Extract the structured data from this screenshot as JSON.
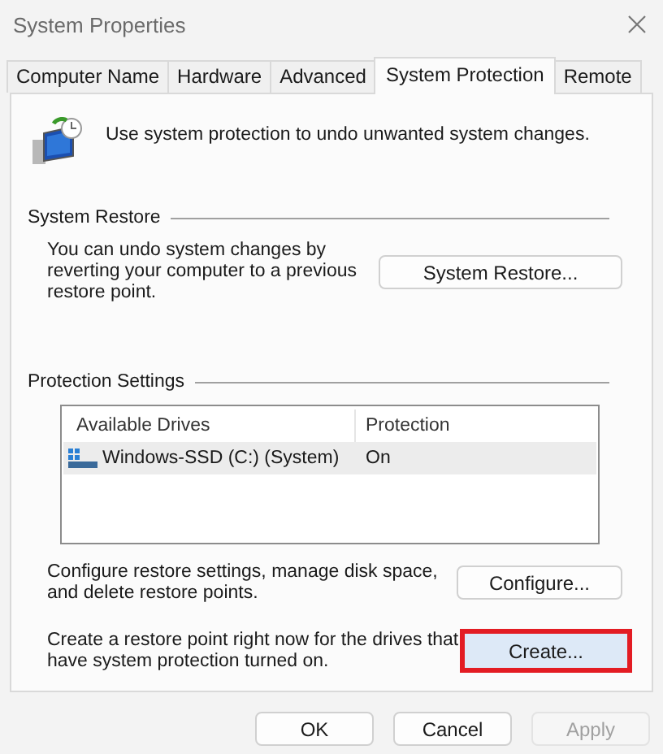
{
  "window": {
    "title": "System Properties"
  },
  "tabs": [
    {
      "label": "Computer Name",
      "selected": false
    },
    {
      "label": "Hardware",
      "selected": false
    },
    {
      "label": "Advanced",
      "selected": false
    },
    {
      "label": "System Protection",
      "selected": true
    },
    {
      "label": "Remote",
      "selected": false
    }
  ],
  "intro": "Use system protection to undo unwanted system changes.",
  "system_restore": {
    "title": "System Restore",
    "description": "You can undo system changes by reverting your computer to a previous restore point.",
    "button": {
      "label": "System Restore...",
      "highlighted": false,
      "disabled": false
    }
  },
  "protection_settings": {
    "title": "Protection Settings",
    "columns": [
      "Available Drives",
      "Protection"
    ],
    "rows": [
      {
        "drive": "Windows-SSD (C:) (System)",
        "protection": "On",
        "selected": true
      }
    ],
    "configure": {
      "description": "Configure restore settings, manage disk space, and delete restore points.",
      "button": {
        "label": "Configure...",
        "highlighted": false,
        "disabled": false
      }
    },
    "create": {
      "description": "Create a restore point right now for the drives that have system protection turned on.",
      "button": {
        "label": "Create...",
        "highlighted": true,
        "disabled": false
      }
    }
  },
  "footer_buttons": [
    {
      "label": "OK",
      "disabled": false
    },
    {
      "label": "Cancel",
      "disabled": false
    },
    {
      "label": "Apply",
      "disabled": true
    }
  ]
}
